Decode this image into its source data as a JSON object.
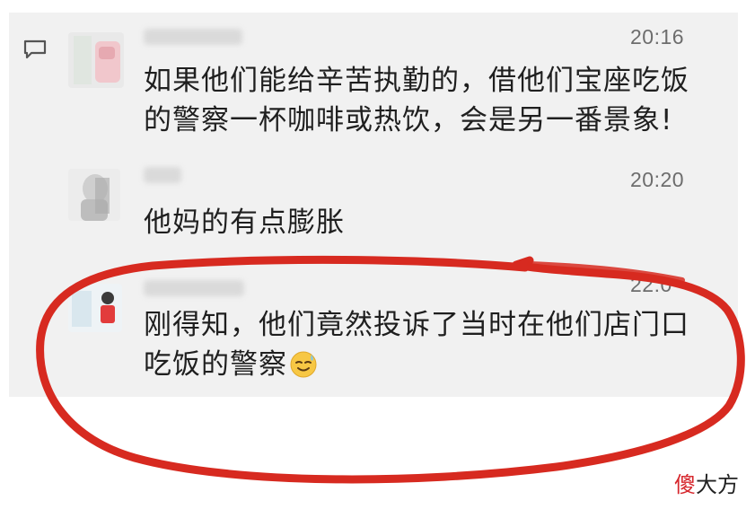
{
  "messages": [
    {
      "time": "20:16",
      "lines": [
        "如果他们能给辛苦执勤的，借他们宝座吃饭",
        "的警察一杯咖啡或热饮，会是另一番景象!"
      ]
    },
    {
      "time": "20:20",
      "lines": [
        "他妈的有点膨胀"
      ]
    },
    {
      "time": "22:0",
      "lines": [
        "刚得知，他们竟然投诉了当时在他们店门口",
        "吃饭的警察"
      ],
      "emoji": "smiling-face-with-sweat-icon"
    }
  ],
  "annotation": {
    "color": "#d72a20",
    "shape": "hand-drawn-ellipse"
  },
  "watermark": {
    "first": "傻",
    "rest": "大方",
    "accent_color": "#d6262c"
  },
  "icons": [
    "comment-icon",
    "avatar"
  ]
}
